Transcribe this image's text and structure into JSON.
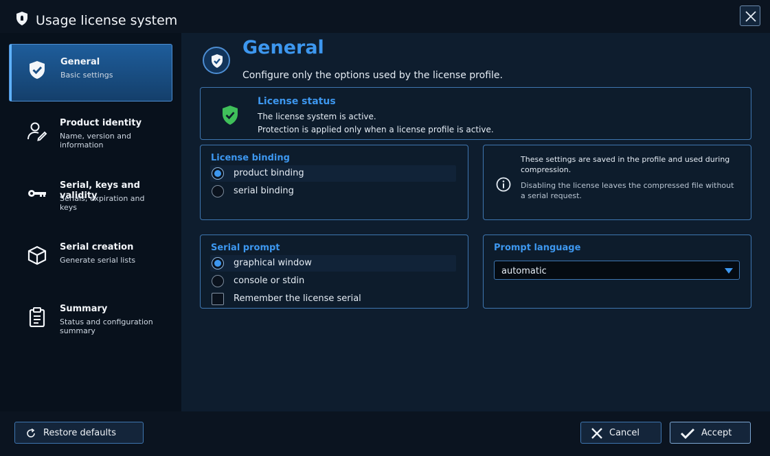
{
  "window": {
    "title": "Usage license system",
    "icon": "shield-lock-icon",
    "close_icon": "close-icon"
  },
  "sidebar": {
    "items": [
      {
        "title": "General",
        "subtitle": "Basic settings",
        "icon": "shield-check-icon",
        "active": true
      },
      {
        "title": "Product identity",
        "subtitle": "Name, version and information",
        "icon": "user-edit-icon",
        "active": false
      },
      {
        "title": "Serial, keys and validity",
        "subtitle": "Serials, expiration and keys",
        "icon": "key-icon",
        "active": false
      },
      {
        "title": "Serial creation",
        "subtitle": "Generate serial lists",
        "icon": "box-icon",
        "active": false
      },
      {
        "title": "Summary",
        "subtitle": "Status and configuration summary",
        "icon": "clipboard-icon",
        "active": false
      }
    ]
  },
  "main": {
    "title": "General",
    "subtitle": "Configure only the options used by the license profile.",
    "status": {
      "title": "License status",
      "line1": "The license system is active.",
      "line2": "Protection is applied only when a license profile is active."
    },
    "binding": {
      "title": "License binding",
      "options": [
        {
          "label": "product binding",
          "checked": true
        },
        {
          "label": "serial binding",
          "checked": false
        }
      ]
    },
    "info": {
      "line1": "These settings are saved in the profile and used during compression.",
      "line2": "Disabling the license leaves the compressed file without a serial request."
    },
    "prompt": {
      "title": "Serial prompt",
      "options": [
        {
          "label": "graphical window",
          "checked": true
        },
        {
          "label": "console or stdin",
          "checked": false
        }
      ],
      "remember_label": "Remember the license serial",
      "remember_checked": false
    },
    "language": {
      "title": "Prompt language",
      "value": "automatic"
    }
  },
  "footer": {
    "restore_label": "Restore defaults",
    "cancel_label": "Cancel",
    "accept_label": "Accept"
  },
  "colors": {
    "accent": "#3d97ef",
    "success": "#3fbf5a",
    "background": "#0e1d2e"
  }
}
